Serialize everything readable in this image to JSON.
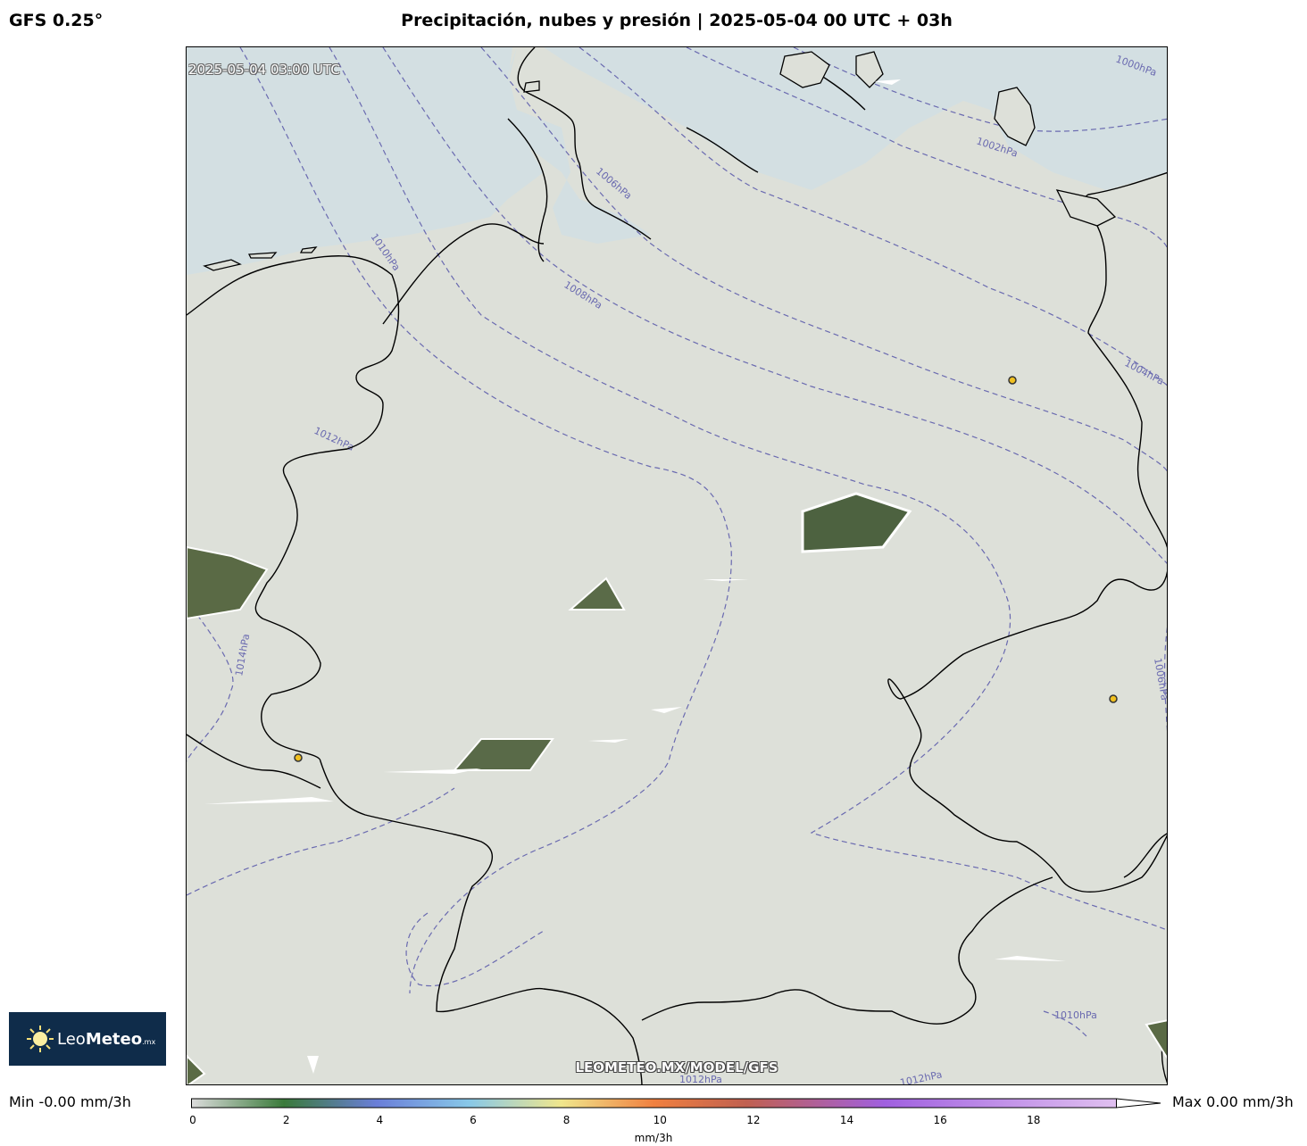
{
  "header": {
    "model": "GFS 0.25°",
    "title": "Precipitación, nubes y presión | 2025-05-04 00 UTC + 03h"
  },
  "map": {
    "valid_time": "2025-05-04 03:00 UTC",
    "watermark": "LEOMETEO.MX/MODEL/GFS",
    "isobar_labels": [
      "1000hPa",
      "1002hPa",
      "1004hPa",
      "1006hPa",
      "1006hPa",
      "1008hPa",
      "1010hPa",
      "1010hPa",
      "1012hPa",
      "1012hPa",
      "1012hPa",
      "1014hPa"
    ],
    "colors": {
      "land": "#dde0d9",
      "sea": "#d3dfe2",
      "isobar": "#6a6ab0",
      "cities": "#f0c020"
    }
  },
  "logo": {
    "name_light": "Leo",
    "name_bold": "Meteo",
    "suffix": ".mx",
    "icon": "sun-icon"
  },
  "colorbar": {
    "min_label": "Min -0.00 mm/3h",
    "max_label": "Max 0.00 mm/3h",
    "ticks": [
      "0",
      "2",
      "4",
      "6",
      "8",
      "10",
      "12",
      "14",
      "16",
      "18"
    ],
    "tick_values": [
      0,
      2,
      4,
      6,
      8,
      10,
      12,
      14,
      16,
      18
    ],
    "max_value": 19.8,
    "unit": "mm/3h",
    "stops": [
      "#dcdcdc",
      "#3a7a3a",
      "#6a7ed8",
      "#88c8e8",
      "#f0e68c",
      "#f08040",
      "#c06050",
      "#a060e0",
      "#e0c0f0"
    ]
  }
}
